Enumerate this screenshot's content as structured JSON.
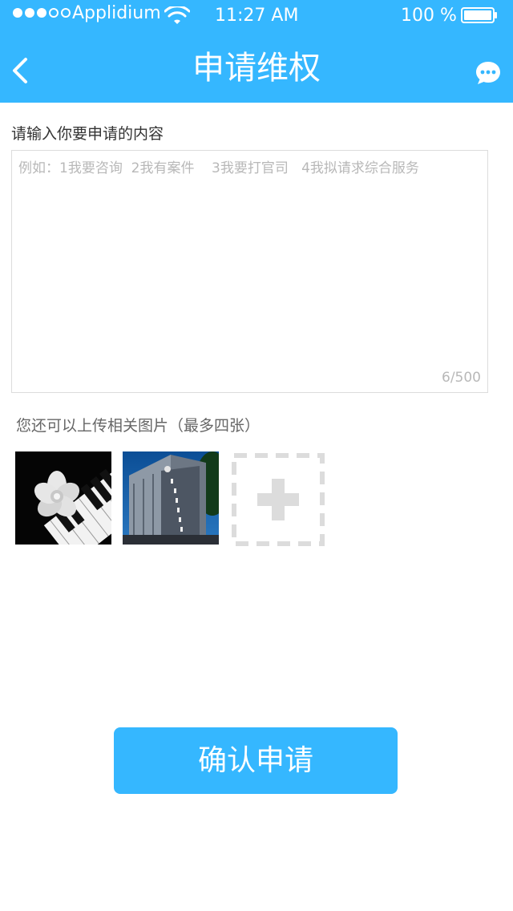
{
  "status_bar": {
    "carrier": "Applidium",
    "time": "11:27 AM",
    "battery": "100 %"
  },
  "nav": {
    "title": "申请维权"
  },
  "form": {
    "content_label": "请输入你要申请的内容",
    "content_placeholder": "例如：1我要咨询  2我有案件    3我要打官司   4我拟请求综合服务",
    "char_counter": "6/500",
    "upload_label": "您还可以上传相关图片（最多四张）"
  },
  "actions": {
    "confirm_label": "确认申请"
  },
  "icons": {
    "back": "chevron-left-icon",
    "chat": "chat-bubble-icon",
    "add": "plus-icon",
    "wifi": "wifi-icon",
    "battery": "battery-icon"
  },
  "colors": {
    "accent": "#35b7ff",
    "text_dark": "#333333",
    "text_muted": "#b8b8b8",
    "border": "#dcdcdc"
  }
}
